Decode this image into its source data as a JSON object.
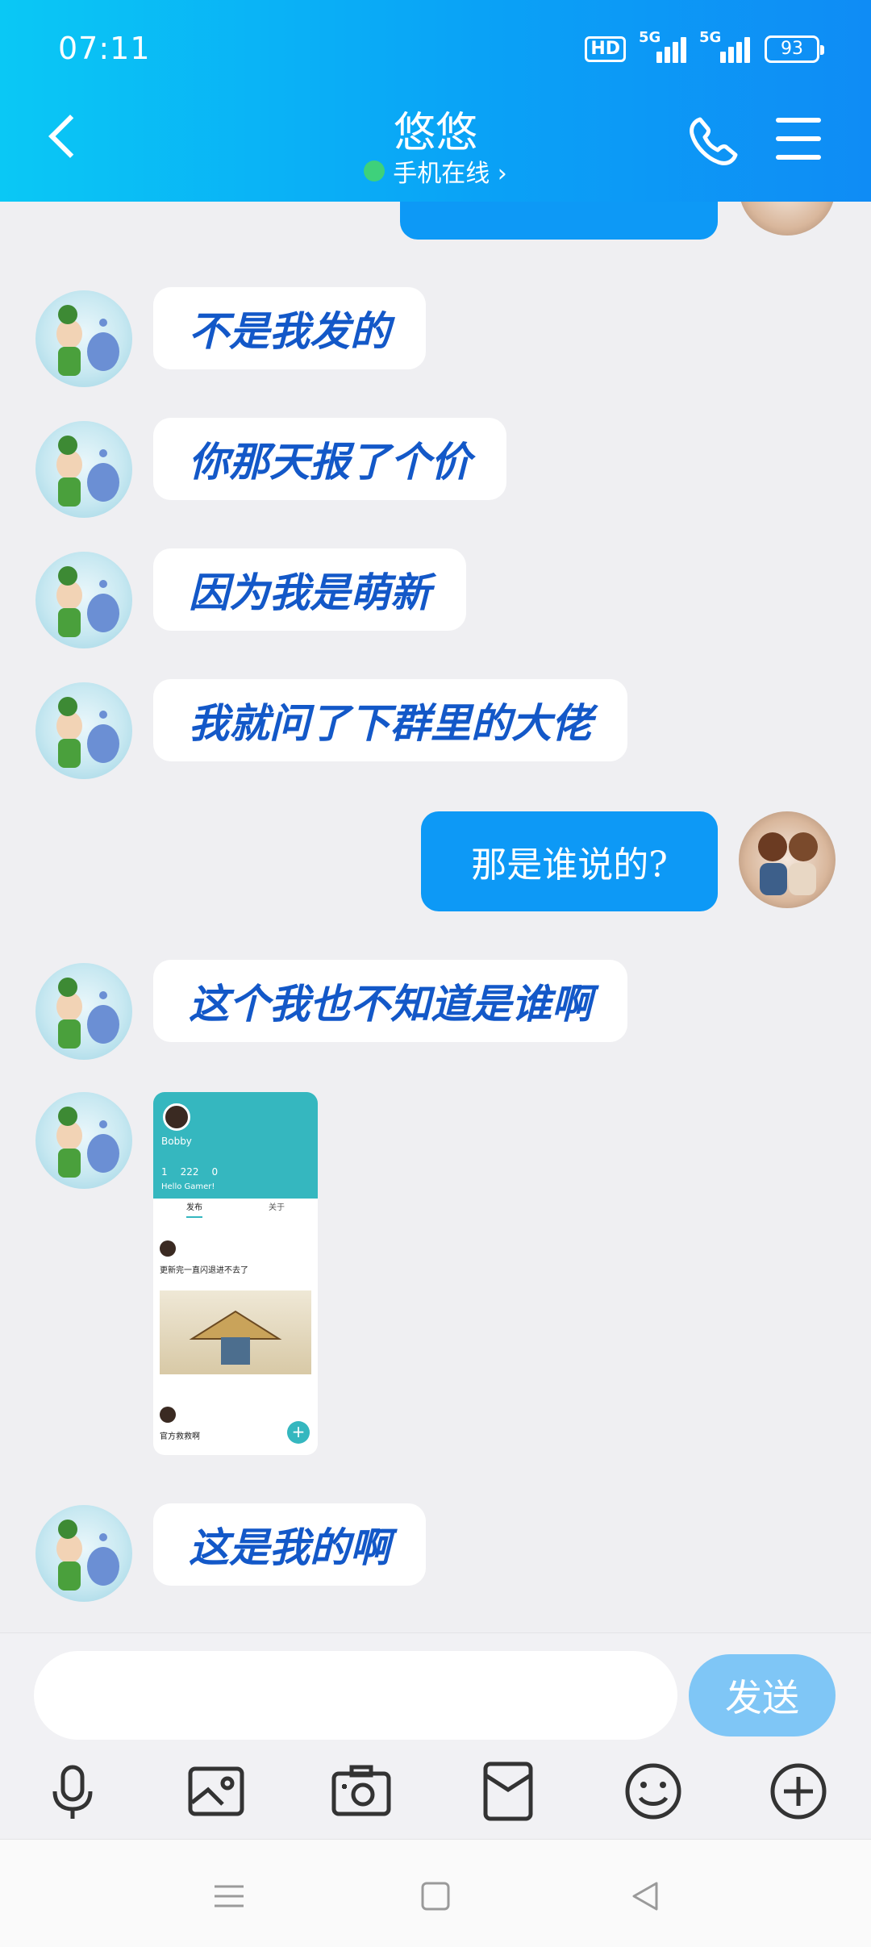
{
  "status_bar": {
    "time": "07:11",
    "hd_label": "HD",
    "signal_1": "5G",
    "signal_2": "5G",
    "battery": "93"
  },
  "header": {
    "back_icon": "chevron-left-icon",
    "title": "悠悠",
    "subtitle": "手机在线 ›",
    "call_icon": "phone-icon",
    "menu_icon": "hamburger-menu-icon"
  },
  "messages": [
    {
      "side": "left",
      "text": "不是我发的"
    },
    {
      "side": "left",
      "text": "你那天报了个价"
    },
    {
      "side": "left",
      "text": "因为我是萌新"
    },
    {
      "side": "left",
      "text": "我就问了下群里的大佬"
    },
    {
      "side": "right",
      "text": "那是谁说的?"
    },
    {
      "side": "left",
      "text": "这个我也不知道是谁啊"
    },
    {
      "side": "left",
      "type": "image"
    },
    {
      "side": "left",
      "text": "这是我的啊"
    }
  ],
  "screenshot_card": {
    "name": "Bobby",
    "stats": [
      "1",
      "222",
      "0"
    ],
    "bio": "Hello Gamer!",
    "tabs": [
      "发布",
      "关于"
    ],
    "post_title": "更新完一直闪退进不去了",
    "post_title_2": "官方救救啊"
  },
  "input": {
    "placeholder": "",
    "send_label": "发送"
  },
  "toolbar": [
    "microphone-icon",
    "picture-icon",
    "camera-icon",
    "red-packet-icon",
    "emoji-icon",
    "plus-icon"
  ],
  "nav_bar": [
    "menu-nav-icon",
    "home-square-icon",
    "back-triangle-icon"
  ],
  "colors": {
    "header_start": "#0ac8f5",
    "header_end": "#0f8cf5",
    "my_bubble": "#0d99f6",
    "their_text": "#1358c8",
    "send_button": "#7fc6f6",
    "online": "#3ed17b"
  }
}
